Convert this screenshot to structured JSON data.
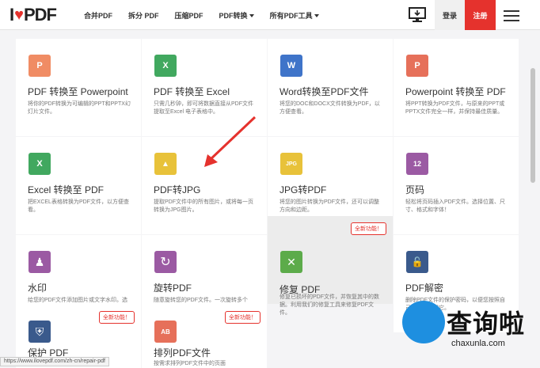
{
  "nav": {
    "logo_i": "I",
    "logo_pdf": "PDF",
    "items": [
      "合并PDF",
      "拆分 PDF",
      "压缩PDF",
      "PDF转换",
      "所有PDF工具"
    ],
    "login": "登录",
    "signup": "注册"
  },
  "cards": [
    {
      "title": "PDF 转换至 Powerpoint",
      "desc": "将你的PDF转换为可编辑的PPT和PPTX幻灯片文件。",
      "icon": "P",
      "color": "#f08c64"
    },
    {
      "title": "PDF 转换至 Excel",
      "desc": "只需几秒钟，即可将数据直接从PDF文件提取至Excel 电子表格中。",
      "icon": "X",
      "color": "#41a85f"
    },
    {
      "title": "Word转换至PDF文件",
      "desc": "将您的DOC和DOCX文件转换为PDF，以方便查看。",
      "icon": "W",
      "color": "#3f74c9"
    },
    {
      "title": "Powerpoint 转换至 PDF",
      "desc": "将PPT转换为PDF文件，与原来的PPT或PPTX文件完全一样，并保持最佳质量。",
      "icon": "P",
      "color": "#e6705a"
    },
    {
      "title": "Excel 转换至 PDF",
      "desc": "把EXCEL表格转换为PDF文件，以方便查看。",
      "icon": "X",
      "color": "#41a85f"
    },
    {
      "title": "PDF转JPG",
      "desc": "提取PDF文件中的所有图片，或将每一页转换为JPG图片。",
      "icon": "▲",
      "color": "#e8c23a"
    },
    {
      "title": "JPG转PDF",
      "desc": "将您的图片转换为PDF文件，还可以调整方向和边距。",
      "icon": "JPG",
      "color": "#e8c23a"
    },
    {
      "title": "页码",
      "desc": "轻松将页码插入PDF文件。选择位置、尺寸、格式和字体！",
      "icon": "12",
      "color": "#9b5aa3"
    },
    {
      "title": "水印",
      "desc": "给您的PDF文件添加图片或文字水印。选择位置、透明度和字体。",
      "icon": "♟",
      "color": "#9b5aa3"
    },
    {
      "title": "旋转PDF",
      "desc": "随意旋转您的PDF文件。一次旋转多个PDF文件！",
      "icon": "↻",
      "color": "#9b5aa3"
    },
    {
      "title": "修复 PDF",
      "desc": "修复已损坏的PDF文件，并恢复其中的数据。利用我们的修复工具来修复PDF文件。",
      "icon": "✕",
      "color": "#5cab4a",
      "badge": "全新功能！"
    },
    {
      "title": "PDF解密",
      "desc": "删除PDF文件的保护密码，以便您按照自己的需求使用它。",
      "icon": "🔓",
      "color": "#3a5a8c"
    },
    {
      "title": "保护 PDF",
      "desc": "",
      "icon": "⛨",
      "color": "#3a5a8c",
      "badge": "全新功能！"
    },
    {
      "title": "排列PDF文件",
      "desc": "按需求排列PDF文件中的页面",
      "icon": "AB",
      "color": "#e6705a",
      "badge": "全新功能！"
    }
  ],
  "status_url": "https://www.ilovepdf.com/zh-cn/repair-pdf",
  "watermark": {
    "text": "查询啦",
    "sub": "chaxunla.com"
  }
}
